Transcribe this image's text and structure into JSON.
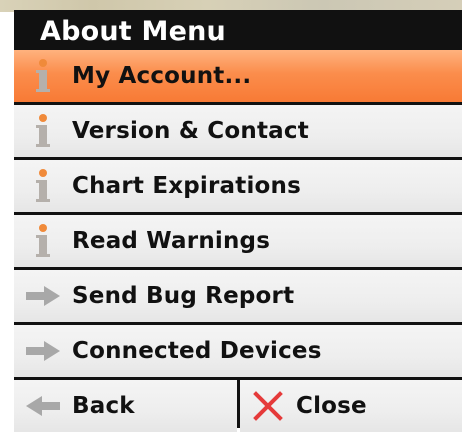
{
  "menu": {
    "title": "About Menu",
    "items": [
      {
        "label": "My Account...",
        "icon": "info-icon",
        "selected": true
      },
      {
        "label": "Version & Contact",
        "icon": "info-icon",
        "selected": false
      },
      {
        "label": "Chart Expirations",
        "icon": "info-icon",
        "selected": false
      },
      {
        "label": "Read Warnings",
        "icon": "info-icon",
        "selected": false
      },
      {
        "label": "Send Bug Report",
        "icon": "arrow-right-icon",
        "selected": false
      },
      {
        "label": "Connected Devices",
        "icon": "arrow-right-icon",
        "selected": false
      }
    ],
    "back_label": "Back",
    "close_label": "Close"
  },
  "colors": {
    "accent_selected": "#f98a47",
    "info_icon_top": "#f08a3a",
    "info_icon_stem": "#b5b0ab",
    "arrow_icon": "#a8a8a8",
    "close_icon": "#e53a3a"
  }
}
